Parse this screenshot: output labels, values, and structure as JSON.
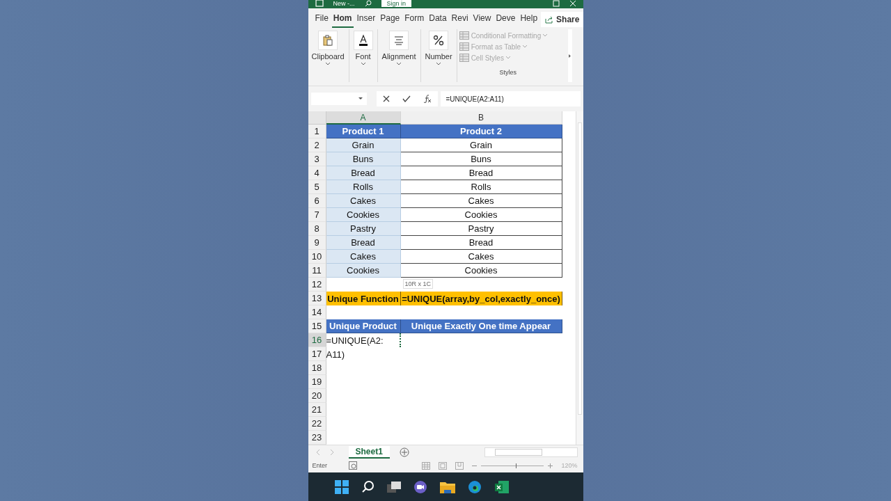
{
  "title_bar": {
    "title": "New -...",
    "sign_in": "Sign in"
  },
  "ribbon_tabs": [
    {
      "label": "File",
      "selected": false
    },
    {
      "label": "Hom",
      "selected": true
    },
    {
      "label": "Inser",
      "selected": false
    },
    {
      "label": "Page",
      "selected": false
    },
    {
      "label": "Form",
      "selected": false
    },
    {
      "label": "Data",
      "selected": false
    },
    {
      "label": "Revi",
      "selected": false
    },
    {
      "label": "View",
      "selected": false
    },
    {
      "label": "Deve",
      "selected": false
    },
    {
      "label": "Help",
      "selected": false
    }
  ],
  "share": "Share",
  "ribbon_groups": [
    {
      "kind": "clipboard",
      "label": "Clipboard"
    },
    {
      "kind": "font",
      "label": "Font"
    },
    {
      "kind": "alignment",
      "label": "Alignment"
    },
    {
      "kind": "number",
      "label": "Number"
    }
  ],
  "styles": {
    "items": [
      {
        "label": "Conditional Formatting",
        "disabled": true
      },
      {
        "label": "Format as Table",
        "disabled": true
      },
      {
        "label": "Cell Styles",
        "disabled": true
      }
    ],
    "label": "Styles"
  },
  "formula_bar": {
    "formula": "=UNIQUE(A2:A11)"
  },
  "columns": [
    {
      "label": "A",
      "selected": true
    },
    {
      "label": "B",
      "selected": false
    }
  ],
  "rows": [
    {
      "number": "1",
      "selected": false,
      "cells": [
        {
          "text": "Product 1",
          "kind": "header",
          "selected": false
        },
        {
          "text": "Product 2",
          "kind": "header",
          "selected": false
        }
      ]
    },
    {
      "number": "2",
      "selected": false,
      "cells": [
        {
          "text": "Grain",
          "kind": "data",
          "selected": true
        },
        {
          "text": "Grain",
          "kind": "data",
          "selected": false
        }
      ]
    },
    {
      "number": "3",
      "selected": false,
      "cells": [
        {
          "text": "Buns",
          "kind": "data",
          "selected": true
        },
        {
          "text": "Buns",
          "kind": "data",
          "selected": false
        }
      ]
    },
    {
      "number": "4",
      "selected": false,
      "cells": [
        {
          "text": "Bread",
          "kind": "data",
          "selected": true
        },
        {
          "text": "Bread",
          "kind": "data",
          "selected": false
        }
      ]
    },
    {
      "number": "5",
      "selected": false,
      "cells": [
        {
          "text": "Rolls",
          "kind": "data",
          "selected": true
        },
        {
          "text": "Rolls",
          "kind": "data",
          "selected": false
        }
      ]
    },
    {
      "number": "6",
      "selected": false,
      "cells": [
        {
          "text": "Cakes",
          "kind": "data",
          "selected": true
        },
        {
          "text": "Cakes",
          "kind": "data",
          "selected": false
        }
      ]
    },
    {
      "number": "7",
      "selected": false,
      "cells": [
        {
          "text": "Cookies",
          "kind": "data",
          "selected": true
        },
        {
          "text": "Cookies",
          "kind": "data",
          "selected": false
        }
      ]
    },
    {
      "number": "8",
      "selected": false,
      "cells": [
        {
          "text": "Pastry",
          "kind": "data",
          "selected": true
        },
        {
          "text": "Pastry",
          "kind": "data",
          "selected": false
        }
      ]
    },
    {
      "number": "9",
      "selected": false,
      "cells": [
        {
          "text": "Bread",
          "kind": "data",
          "selected": true
        },
        {
          "text": "Bread",
          "kind": "data",
          "selected": false
        }
      ]
    },
    {
      "number": "10",
      "selected": false,
      "cells": [
        {
          "text": "Cakes",
          "kind": "data",
          "selected": true
        },
        {
          "text": "Cakes",
          "kind": "data",
          "selected": false
        }
      ]
    },
    {
      "number": "11",
      "selected": false,
      "cells": [
        {
          "text": "Cookies",
          "kind": "data",
          "selected": true
        },
        {
          "text": "Cookies",
          "kind": "data",
          "selected": false
        }
      ]
    },
    {
      "number": "12",
      "selected": false,
      "tooltip": "10R x 1C",
      "cells": [
        {
          "kind": "empty",
          "selected": false
        },
        {
          "kind": "empty",
          "selected": false
        }
      ]
    },
    {
      "number": "13",
      "selected": false,
      "cells": [
        {
          "text": "Unique Function",
          "kind": "highlight",
          "selected": false
        },
        {
          "text": "=UNIQUE(array,by_col,exactly_once)",
          "kind": "highlight",
          "selected": false
        }
      ]
    },
    {
      "number": "14",
      "selected": false,
      "cells": [
        {
          "kind": "empty",
          "selected": false
        },
        {
          "kind": "empty",
          "selected": false
        }
      ]
    },
    {
      "number": "15",
      "selected": false,
      "cells": [
        {
          "text": "Unique Product",
          "kind": "header",
          "selected": false
        },
        {
          "text": "Unique Exactly One time Appear",
          "kind": "header",
          "selected": false
        }
      ]
    },
    {
      "number": "16",
      "selected": true,
      "cells": [
        {
          "text": "=UNIQUE(A2:",
          "kind": "editing",
          "selected": true
        },
        {
          "kind": "empty",
          "selected": false
        }
      ]
    },
    {
      "number": "17",
      "selected": false,
      "cells": [
        {
          "text": "A11)",
          "kind": "editing",
          "selected": false
        },
        {
          "kind": "empty",
          "selected": false
        }
      ]
    },
    {
      "number": "18",
      "selected": false,
      "cells": [
        {
          "kind": "empty",
          "selected": false
        },
        {
          "kind": "empty",
          "selected": false
        }
      ]
    },
    {
      "number": "19",
      "selected": false,
      "cells": [
        {
          "kind": "empty",
          "selected": false
        },
        {
          "kind": "empty",
          "selected": false
        }
      ]
    },
    {
      "number": "20",
      "selected": false,
      "cells": [
        {
          "kind": "empty",
          "selected": false
        },
        {
          "kind": "empty",
          "selected": false
        }
      ]
    },
    {
      "number": "21",
      "selected": false,
      "cells": [
        {
          "kind": "empty",
          "selected": false
        },
        {
          "kind": "empty",
          "selected": false
        }
      ]
    },
    {
      "number": "22",
      "selected": false,
      "cells": [
        {
          "kind": "empty",
          "selected": false
        },
        {
          "kind": "empty",
          "selected": false
        }
      ]
    },
    {
      "number": "23",
      "selected": false,
      "cells": [
        {
          "kind": "empty",
          "selected": false
        },
        {
          "kind": "empty",
          "selected": false
        }
      ]
    }
  ],
  "sheet_tabs": [
    {
      "label": "Sheet1",
      "selected": true
    }
  ],
  "status_bar": {
    "mode": "Enter",
    "zoom": "120%",
    "level": 0.55
  }
}
